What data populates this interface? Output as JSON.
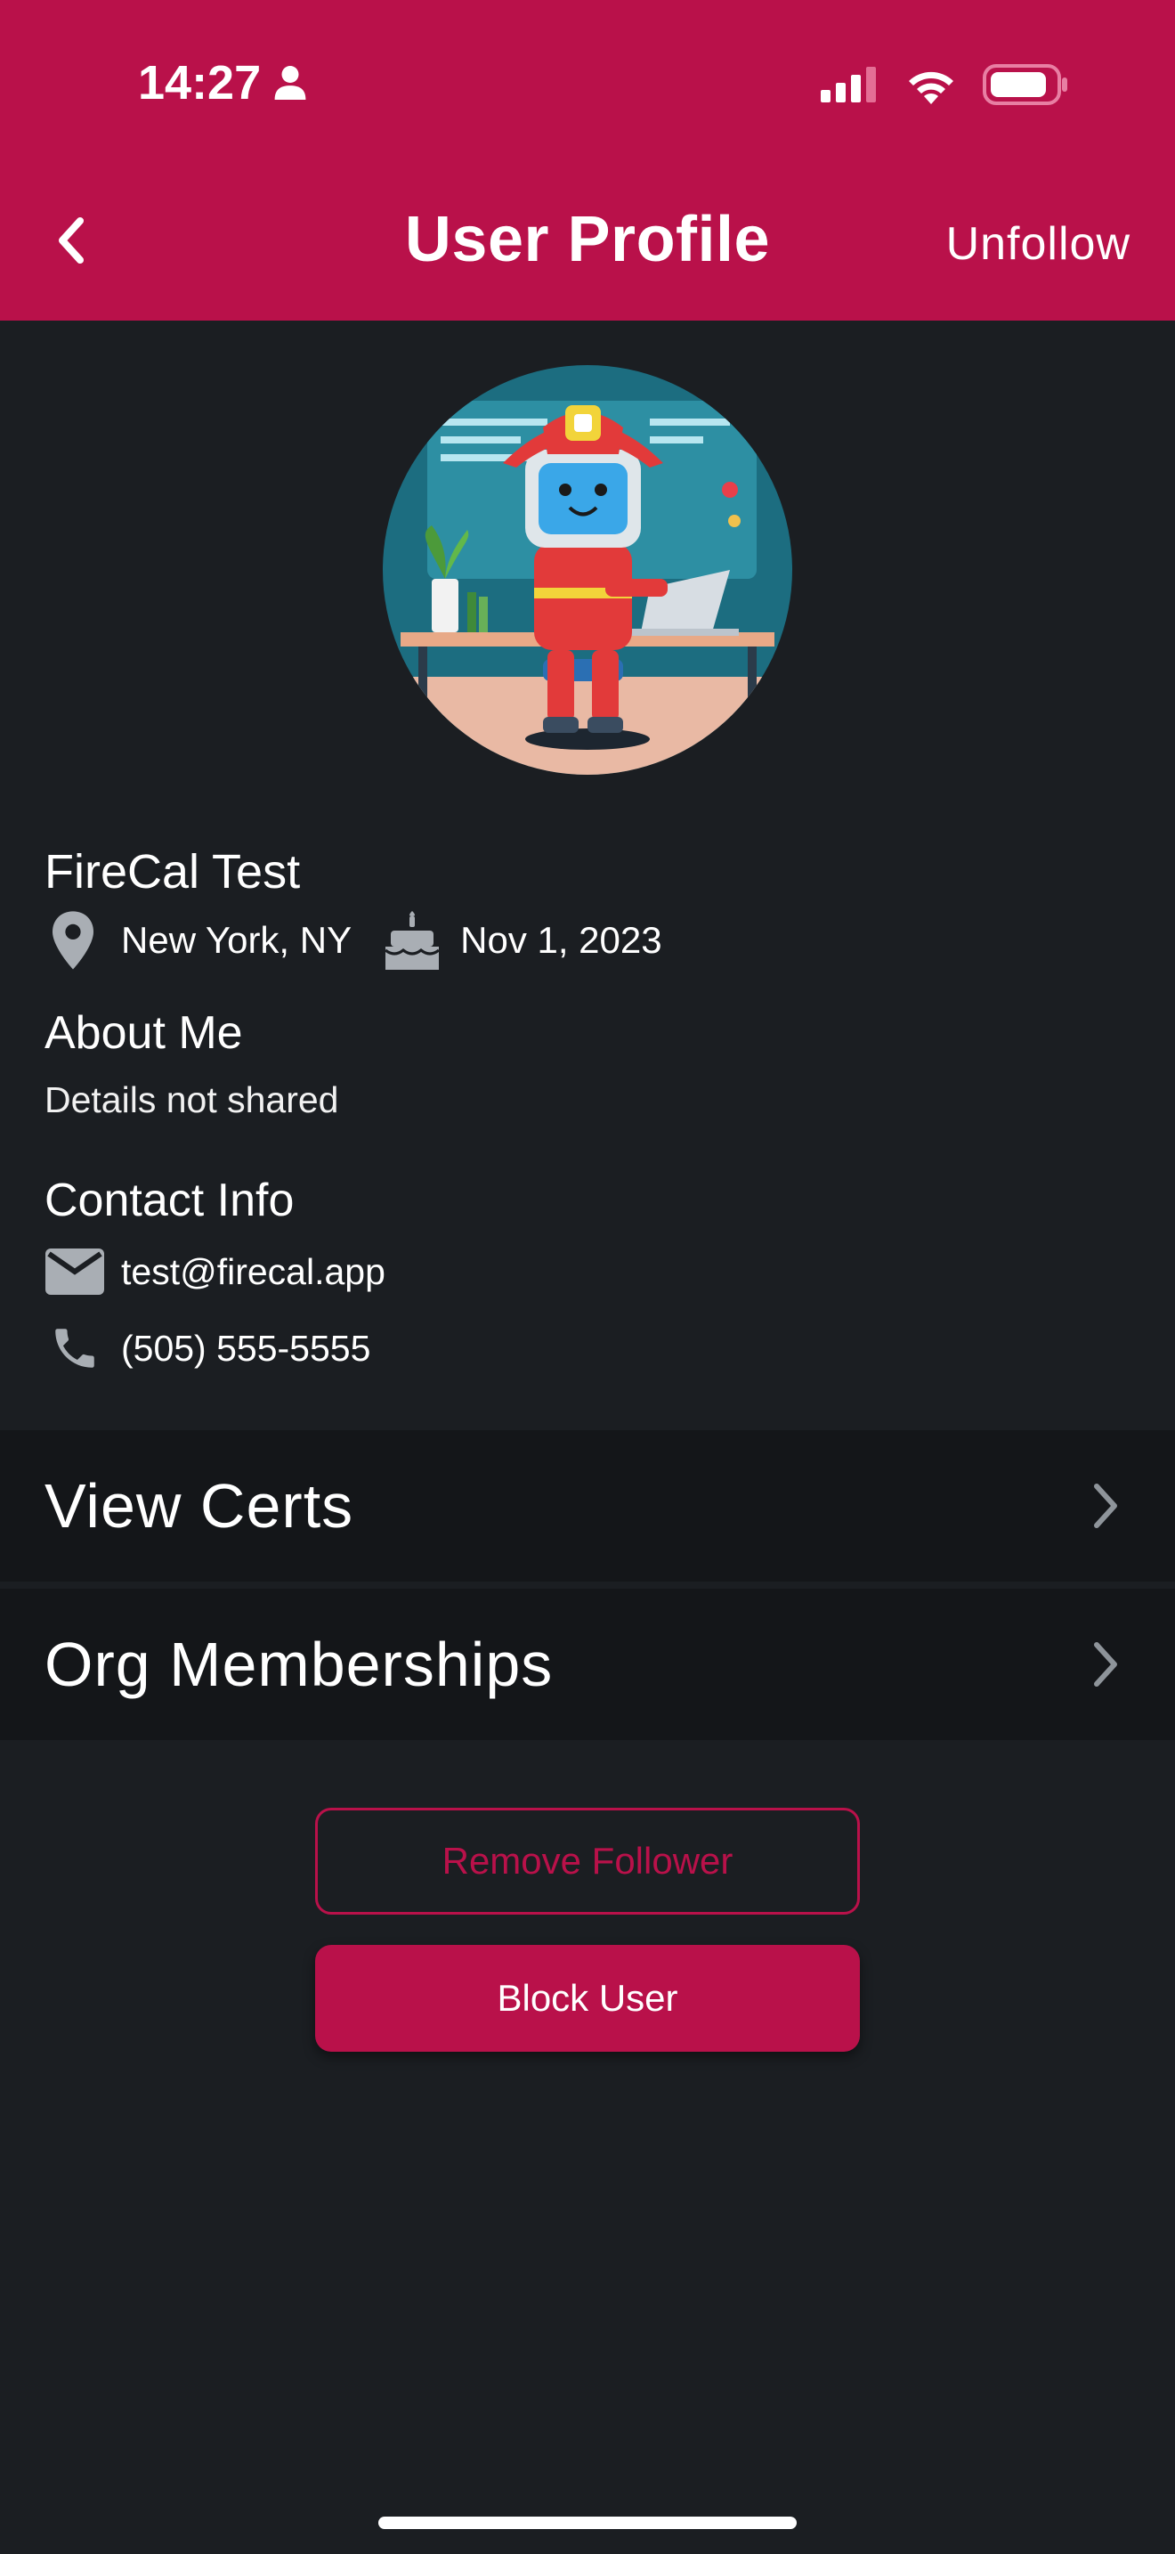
{
  "status_bar": {
    "time": "14:27"
  },
  "header": {
    "title": "User Profile",
    "action_label": "Unfollow"
  },
  "profile": {
    "name": "FireCal Test",
    "location": "New York, NY",
    "birthday": "Nov 1, 2023"
  },
  "about": {
    "title": "About Me",
    "text": "Details not shared"
  },
  "contact": {
    "title": "Contact Info",
    "email": "test@firecal.app",
    "phone": "(505) 555-5555"
  },
  "menu": [
    {
      "label": "View Certs"
    },
    {
      "label": "Org Memberships"
    }
  ],
  "actions": {
    "remove_follower": "Remove Follower",
    "block_user": "Block User"
  },
  "colors": {
    "accent": "#b9114a",
    "background": "#1b1e22",
    "list_background": "#141619"
  }
}
